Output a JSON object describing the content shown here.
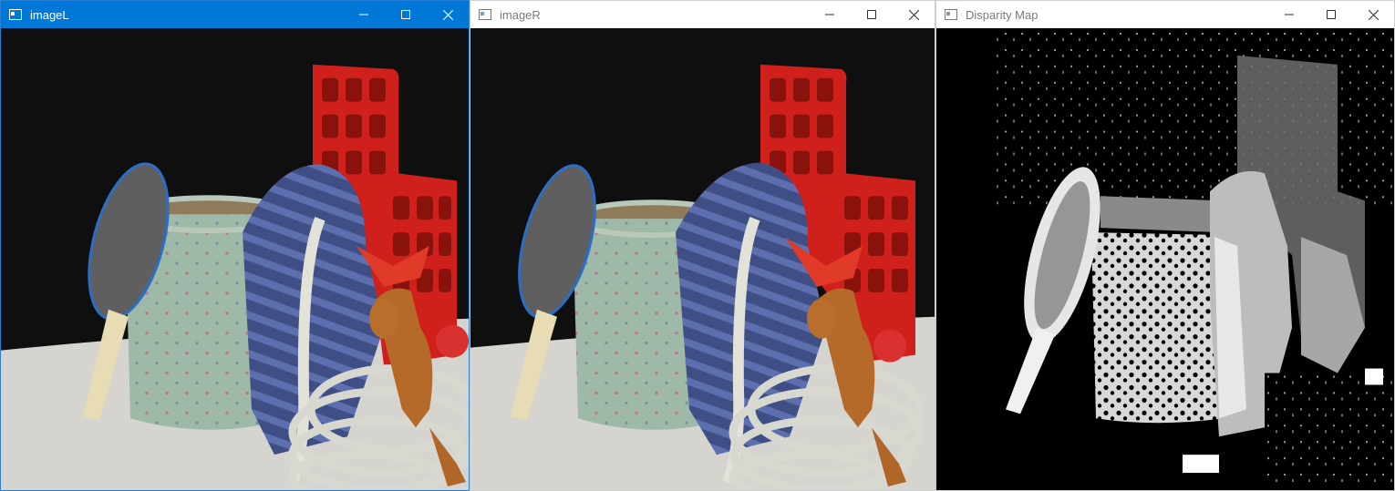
{
  "windows": [
    {
      "title": "imageL",
      "state": "active",
      "icon": "window-app-icon",
      "content": "left-stereo-photo",
      "buttons": [
        "minimize-icon",
        "maximize-icon",
        "close-icon"
      ]
    },
    {
      "title": "imageR",
      "state": "inactive",
      "icon": "window-app-icon",
      "content": "right-stereo-photo",
      "buttons": [
        "minimize-icon",
        "maximize-icon",
        "close-icon"
      ]
    },
    {
      "title": "Disparity Map",
      "state": "inactive",
      "icon": "window-app-icon",
      "content": "grayscale-disparity-image",
      "buttons": [
        "minimize-icon",
        "maximize-icon",
        "close-icon"
      ]
    }
  ],
  "colors": {
    "active_titlebar": "#0078d7",
    "inactive_titlebar": "#ffffff",
    "inactive_title_text": "#7a7a7a"
  }
}
